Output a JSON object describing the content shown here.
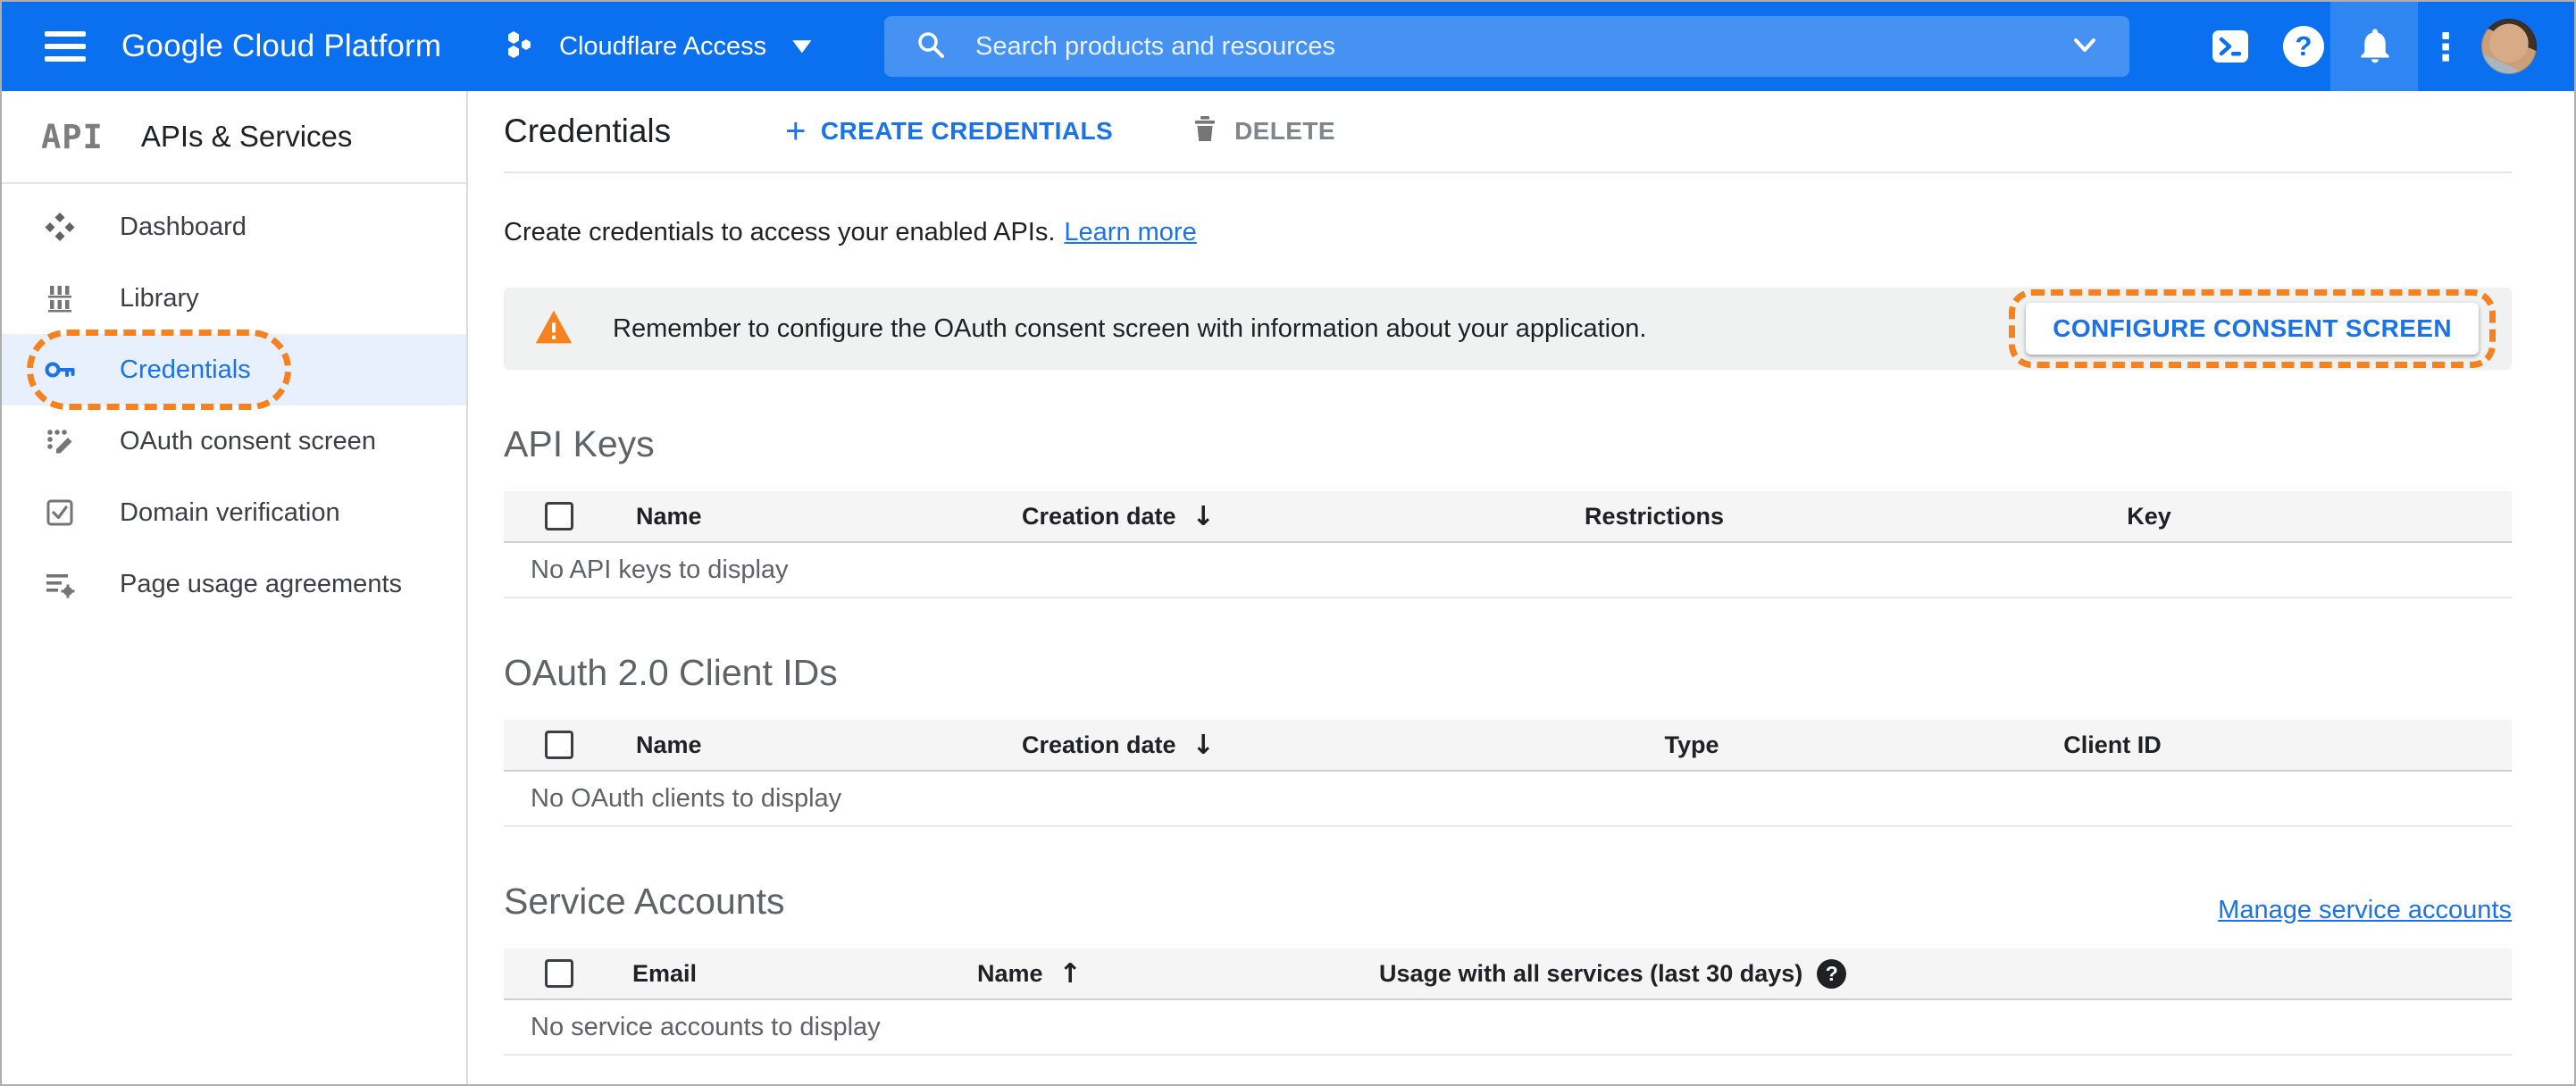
{
  "header": {
    "brand": "Google Cloud Platform",
    "project_selector": {
      "label": "Cloudflare Access"
    },
    "search": {
      "placeholder": "Search products and resources"
    }
  },
  "sidebar": {
    "product_glyph": "API",
    "title": "APIs & Services",
    "items": [
      {
        "label": "Dashboard",
        "selected": false
      },
      {
        "label": "Library",
        "selected": false
      },
      {
        "label": "Credentials",
        "selected": true
      },
      {
        "label": "OAuth consent screen",
        "selected": false
      },
      {
        "label": "Domain verification",
        "selected": false
      },
      {
        "label": "Page usage agreements",
        "selected": false
      }
    ]
  },
  "page": {
    "title": "Credentials",
    "toolbar": {
      "create_label": "CREATE CREDENTIALS",
      "delete_label": "DELETE"
    },
    "intro": {
      "text": "Create credentials to access your enabled APIs.",
      "link": "Learn more"
    },
    "banner": {
      "text": "Remember to configure the OAuth consent screen with information about your application.",
      "button": "CONFIGURE CONSENT SCREEN"
    },
    "sections": {
      "api_keys": {
        "title": "API Keys",
        "columns": [
          "Name",
          "Creation date",
          "Restrictions",
          "Key"
        ],
        "sort": {
          "column": "Creation date",
          "direction": "desc"
        },
        "empty": "No API keys to display"
      },
      "oauth_clients": {
        "title": "OAuth 2.0 Client IDs",
        "columns": [
          "Name",
          "Creation date",
          "Type",
          "Client ID"
        ],
        "sort": {
          "column": "Creation date",
          "direction": "desc"
        },
        "empty": "No OAuth clients to display"
      },
      "service_accounts": {
        "title": "Service Accounts",
        "manage_link": "Manage service accounts",
        "columns": [
          "Email",
          "Name",
          "Usage with all services (last 30 days)"
        ],
        "sort": {
          "column": "Name",
          "direction": "asc"
        },
        "empty": "No service accounts to display"
      }
    }
  },
  "icons": {
    "plus": "+",
    "sort_desc": "↓",
    "sort_asc": "↑",
    "question": "?",
    "kebab": "⋮",
    "caret_down": "▼"
  },
  "colors": {
    "header_blue": "#0b70f0",
    "accent_blue": "#1a73e8",
    "selected_item_bg": "#e8f0fe",
    "annotation_orange": "#f5821f",
    "warning_orange": "#f5821f",
    "banner_bg": "#f0f1f1",
    "table_header_bg": "#f5f5f5",
    "muted_text": "#5f6368"
  }
}
